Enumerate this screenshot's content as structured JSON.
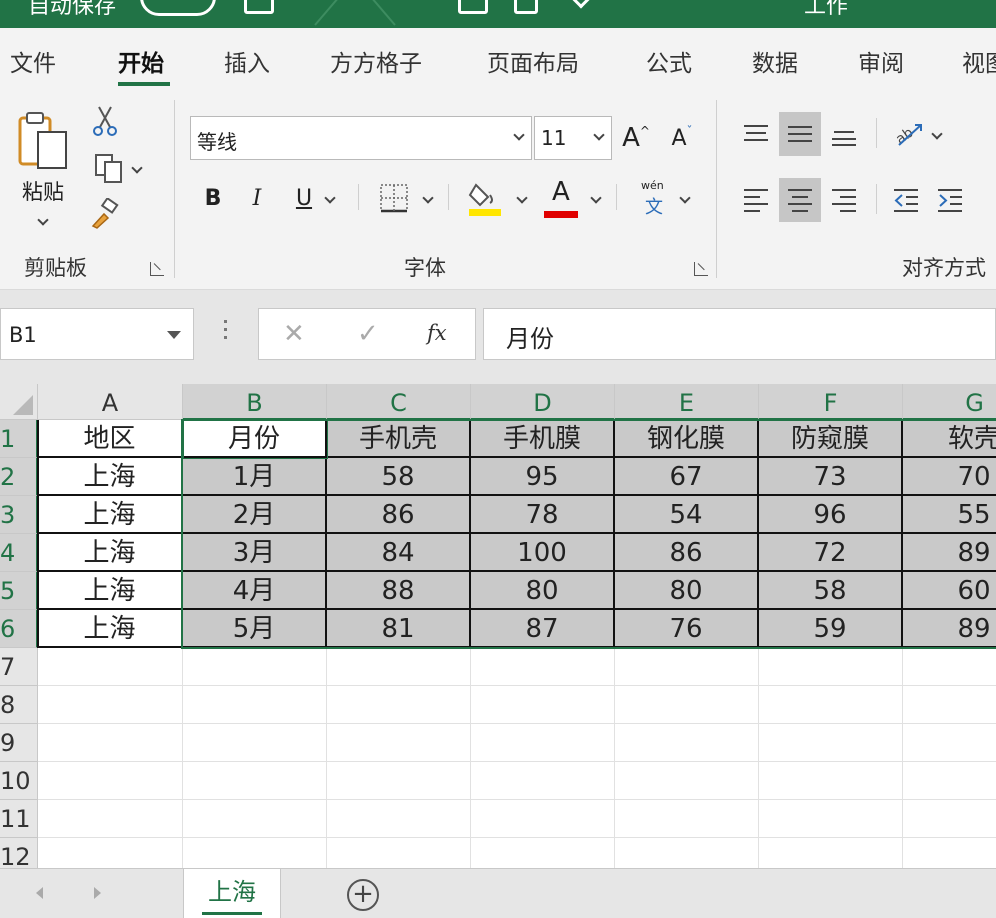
{
  "titlebar": {
    "left_text": "自动保存",
    "right_text": "工作"
  },
  "ribbon_tabs": [
    "文件",
    "开始",
    "插入",
    "方方格子",
    "页面布局",
    "公式",
    "数据",
    "审阅",
    "视图"
  ],
  "active_tab": "开始",
  "clipboard": {
    "paste_label": "粘贴",
    "group_label": "剪贴板"
  },
  "font": {
    "name": "等线",
    "size": "11",
    "grow_label": "A",
    "shrink_label": "A",
    "bold": "B",
    "italic": "I",
    "underline": "U",
    "font_color_label": "A",
    "phonetic_top": "wén",
    "phonetic_bottom": "文",
    "group_label": "字体"
  },
  "alignment": {
    "group_label": "对齐方式"
  },
  "colors": {
    "accent": "#217346",
    "fill_yellow": "#ffe600",
    "font_red": "#e00000",
    "selection_fill": "#c9c9c9"
  },
  "formula_bar": {
    "name_box": "B1",
    "fx": "fx",
    "cancel": "✕",
    "enter": "✓",
    "formula": "月份"
  },
  "columns": [
    "A",
    "B",
    "C",
    "D",
    "E",
    "F",
    "G"
  ],
  "rows": [
    "1",
    "2",
    "3",
    "4",
    "5",
    "6",
    "7",
    "8",
    "9",
    "10",
    "11",
    "12"
  ],
  "table": [
    [
      "地区",
      "月份",
      "手机壳",
      "手机膜",
      "钢化膜",
      "防窥膜",
      "软壳"
    ],
    [
      "上海",
      "1月",
      "58",
      "95",
      "67",
      "73",
      "70"
    ],
    [
      "上海",
      "2月",
      "86",
      "78",
      "54",
      "96",
      "55"
    ],
    [
      "上海",
      "3月",
      "84",
      "100",
      "86",
      "72",
      "89"
    ],
    [
      "上海",
      "4月",
      "88",
      "80",
      "80",
      "58",
      "60"
    ],
    [
      "上海",
      "5月",
      "81",
      "87",
      "76",
      "59",
      "89"
    ]
  ],
  "sheet_tabs": [
    "上海"
  ],
  "add_sheet": "+"
}
